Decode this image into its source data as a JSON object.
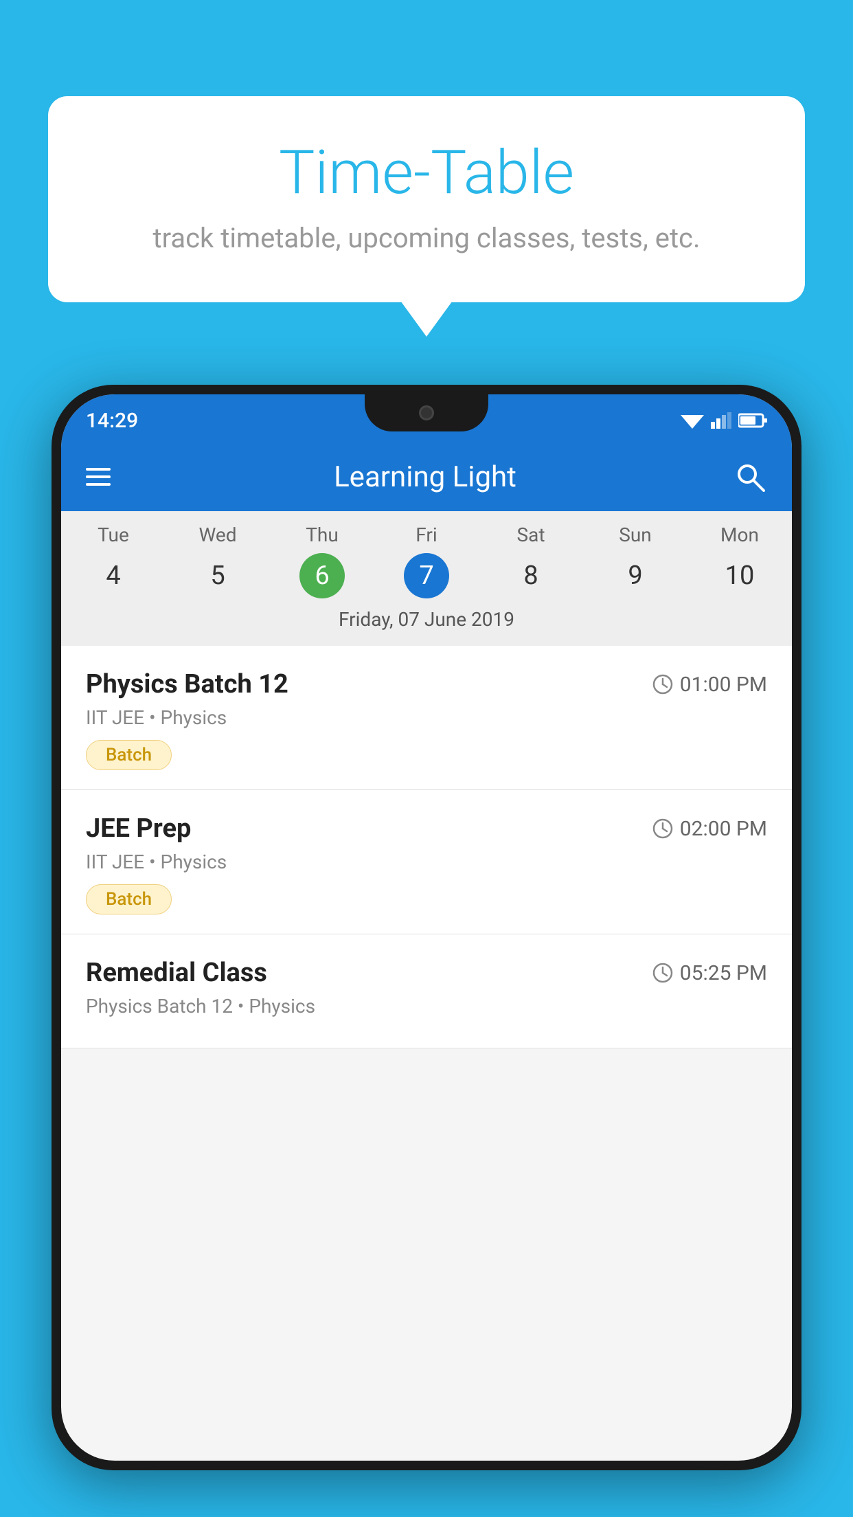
{
  "background_color": "#29b6e8",
  "speech_bubble": {
    "title": "Time-Table",
    "subtitle": "track timetable, upcoming classes, tests, etc."
  },
  "app": {
    "status_time": "14:29",
    "title": "Learning Light"
  },
  "calendar": {
    "days": [
      {
        "label": "Tue",
        "number": "4"
      },
      {
        "label": "Wed",
        "number": "5"
      },
      {
        "label": "Thu",
        "number": "6",
        "state": "today"
      },
      {
        "label": "Fri",
        "number": "7",
        "state": "selected"
      },
      {
        "label": "Sat",
        "number": "8"
      },
      {
        "label": "Sun",
        "number": "9"
      },
      {
        "label": "Mon",
        "number": "10"
      }
    ],
    "selected_date": "Friday, 07 June 2019"
  },
  "schedule": [
    {
      "title": "Physics Batch 12",
      "time": "01:00 PM",
      "subtitle": "IIT JEE • Physics",
      "tag": "Batch"
    },
    {
      "title": "JEE Prep",
      "time": "02:00 PM",
      "subtitle": "IIT JEE • Physics",
      "tag": "Batch"
    },
    {
      "title": "Remedial Class",
      "time": "05:25 PM",
      "subtitle": "Physics Batch 12 • Physics",
      "tag": ""
    }
  ],
  "icons": {
    "hamburger": "hamburger-icon",
    "search": "search-icon",
    "clock": "clock-icon"
  }
}
